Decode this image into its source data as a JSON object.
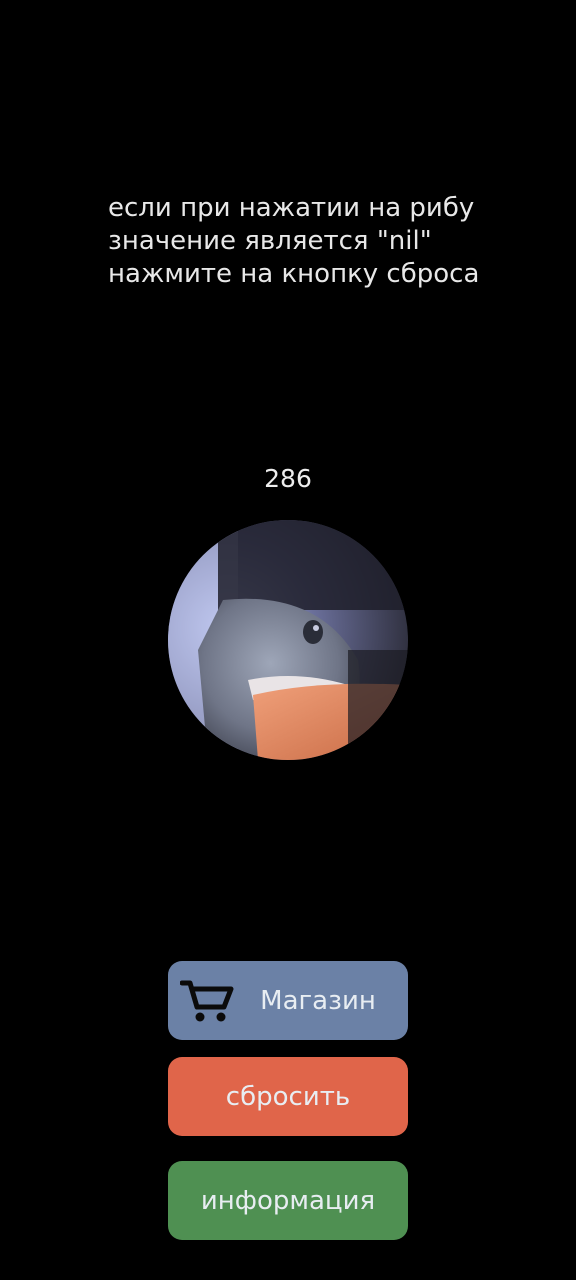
{
  "instructions": {
    "text": "если при нажатии на рибу\nзначение является \"nil\"\nнажмите на кнопку сброса"
  },
  "counter": {
    "value": "286"
  },
  "buttons": {
    "shop": {
      "label": "Магазин",
      "icon": "shopping-cart-icon",
      "color": "#6b81a6"
    },
    "reset": {
      "label": "сбросить",
      "color": "#e0654a"
    },
    "info": {
      "label": "информация",
      "color": "#4f9052"
    }
  }
}
